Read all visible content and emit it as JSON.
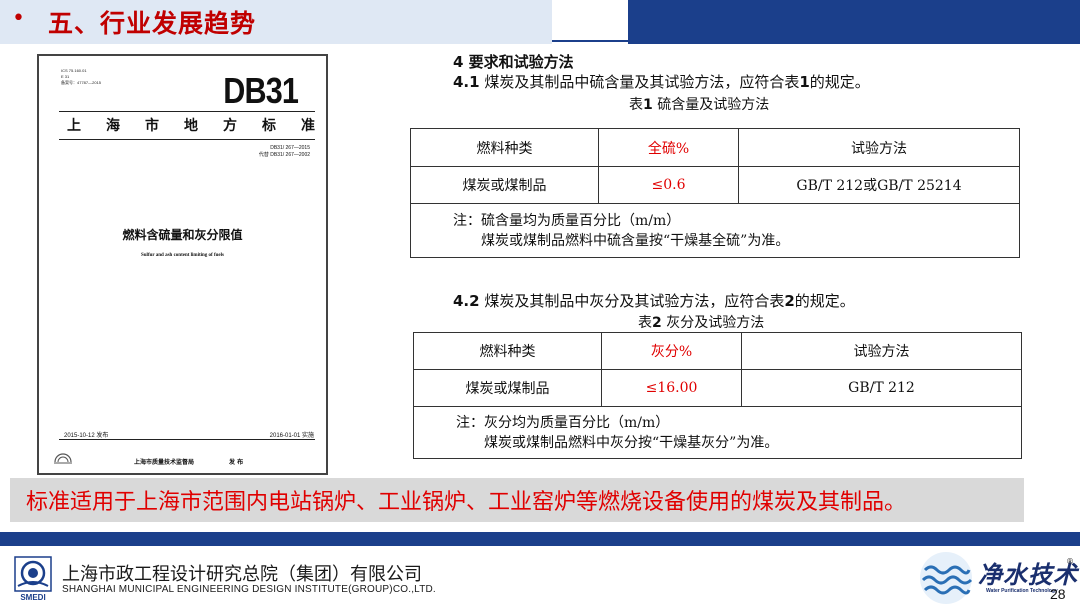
{
  "header": {
    "bullet": "•",
    "title": "五、行业发展趋势"
  },
  "cover": {
    "ics": "ICS 75.160.01",
    "cls": "E 31",
    "record": "备案号：47787—2015",
    "db_mark": "DB31",
    "org_chars": [
      "上",
      "海",
      "市",
      "地",
      "方",
      "标",
      "准"
    ],
    "code": "DB31/ 267—2015",
    "replaces": "代替 DB31/ 267—2002",
    "title": "燃料含硫量和灰分限值",
    "subtitle": "Sulfur and ash content limiting of fuels",
    "issue_date": "2015-10-12 发布",
    "impl_date": "2016-01-01 实施",
    "publisher": "上海市质量技术监督局",
    "publish_mark": "发 布"
  },
  "content": {
    "heading": "4 要求和试验方法",
    "p41_num": "4.1",
    "p41_text_a": " 煤炭及其制品中硫含量及其试验方法，应符合表",
    "p41_ref": "1",
    "p41_text_b": "的规定。",
    "t1_label": "表",
    "t1_num": "1",
    "t1_title": "  硫含量及试验方法",
    "t1_headers": [
      "燃料种类",
      "全硫%",
      "试验方法"
    ],
    "t1_row": [
      "煤炭或煤制品",
      "≤0.6",
      "GB/T 212或GB/T 25214"
    ],
    "t1_note1": "注：硫含量均为质量百分比（m/m）",
    "t1_note2": "煤炭或煤制品燃料中硫含量按“干燥基全硫”为准。",
    "p42_num": "4.2",
    "p42_text_a": " 煤炭及其制品中灰分及其试验方法，应符合表",
    "p42_ref": "2",
    "p42_text_b": "的规定。",
    "t2_label": "表",
    "t2_num": "2",
    "t2_title": "  灰分及试验方法",
    "t2_headers": [
      "燃料种类",
      "灰分%",
      "试验方法"
    ],
    "t2_row": [
      "煤炭或煤制品",
      "≤16.00",
      "GB/T 212"
    ],
    "t2_note1": "注：灰分均为质量百分比（m/m）",
    "t2_note2": "煤炭或煤制品燃料中灰分按“干燥基灰分”为准。"
  },
  "statement": "标准适用于上海市范围内电站锅炉、工业锅炉、工业窑炉等燃烧设备使用的煤炭及其制品。",
  "footer": {
    "logo_text": "SMEDI",
    "company_cn": "上海市政工程设计研究总院（集团）有限公司",
    "company_en": "SHANGHAI MUNICIPAL ENGINEERING DESIGN INSTITUTE(GROUP)CO.,LTD.",
    "brand_name": "净水技术",
    "brand_reg": "®",
    "brand_sub": "Water Purification Technology",
    "page_number": "28"
  },
  "colors": {
    "accent_red": "#e00000",
    "brand_blue": "#1b3f8b",
    "title_band": "#dfe8f4"
  }
}
